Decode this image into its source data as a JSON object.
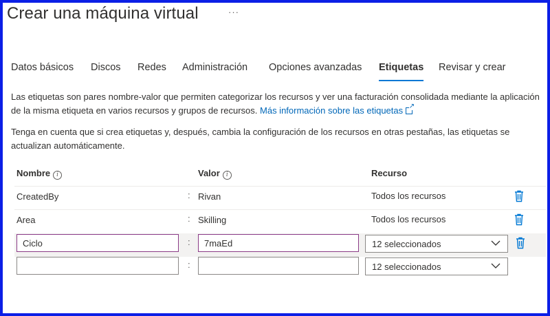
{
  "page": {
    "title": "Crear una máquina virtual",
    "more_label": "···"
  },
  "tabs": [
    {
      "label": "Datos básicos",
      "active": false
    },
    {
      "label": "Discos",
      "active": false
    },
    {
      "label": "Redes",
      "active": false
    },
    {
      "label": "Administración",
      "active": false
    },
    {
      "label": "Opciones avanzadas",
      "active": false
    },
    {
      "label": "Etiquetas",
      "active": true
    },
    {
      "label": "Revisar y crear",
      "active": false
    }
  ],
  "intro": {
    "text": "Las etiquetas son pares nombre-valor que permiten categorizar los recursos y ver una facturación consolidada mediante la aplicación de la misma etiqueta en varios recursos y grupos de recursos.",
    "link": "Más información sobre las etiquetas"
  },
  "note": "Tenga en cuenta que si crea etiquetas y, después, cambia la configuración de los recursos en otras pestañas, las etiquetas se actualizan automáticamente.",
  "table": {
    "headers": {
      "name": "Nombre",
      "value": "Valor",
      "resource": "Recurso"
    },
    "separator": ":",
    "rows": [
      {
        "name": "CreatedBy",
        "value": "Rivan",
        "resource": "Todos los recursos"
      },
      {
        "name": "Area",
        "value": "Skilling",
        "resource": "Todos los recursos"
      }
    ],
    "edit_row": {
      "name": "Ciclo",
      "value": "7maEd",
      "resource": "12 seleccionados"
    },
    "new_row": {
      "name": "",
      "value": "",
      "resource": "12 seleccionados"
    }
  },
  "colors": {
    "accent": "#0078d4",
    "frame": "#0b1fe6",
    "trash": "#0078d4",
    "focus_border": "#8a3a86"
  },
  "icons": {
    "info": "info-icon",
    "delete": "trash-icon",
    "dropdown": "chevron-down-icon",
    "external": "external-link-icon"
  }
}
